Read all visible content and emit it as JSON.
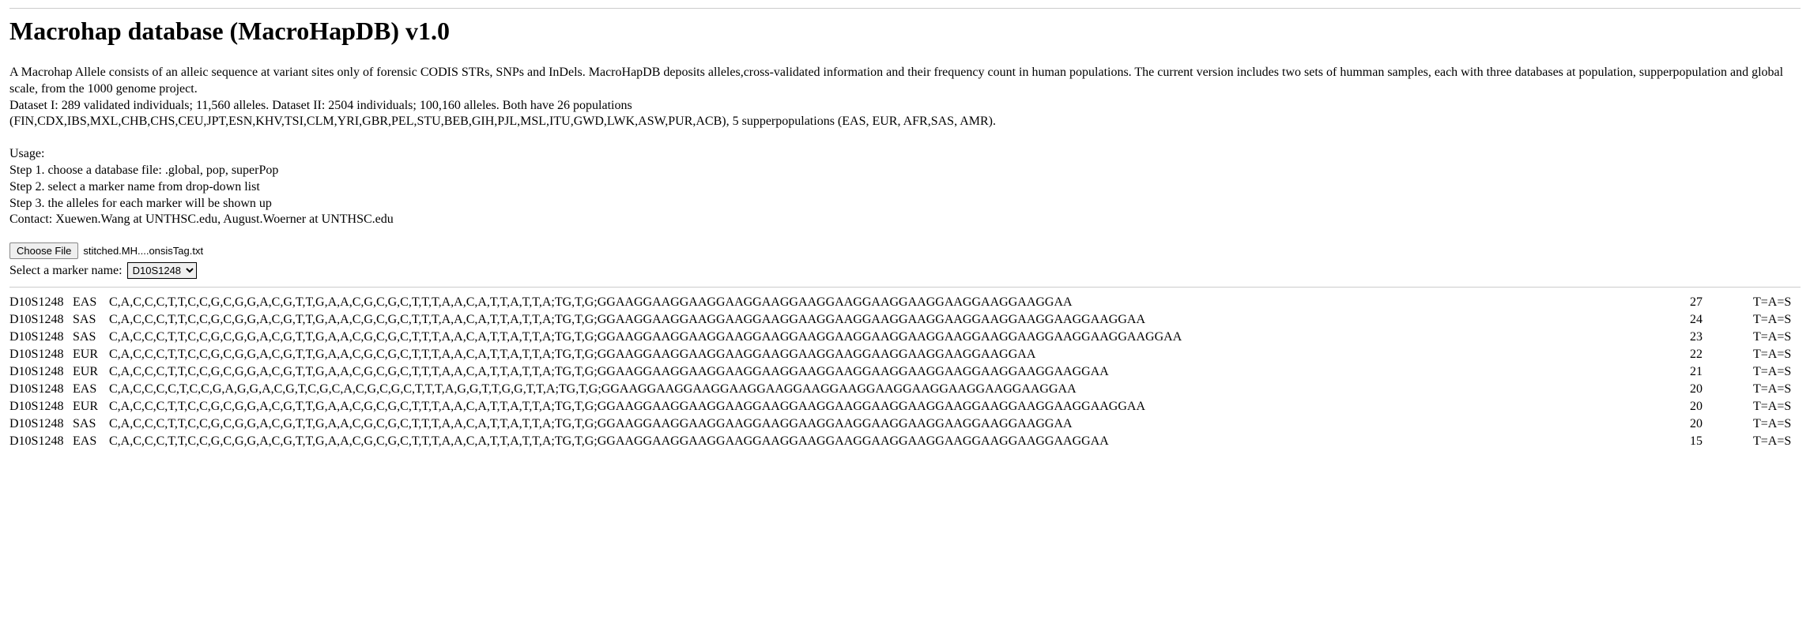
{
  "header": {
    "title": "Macrohap database (MacroHapDB) v1.0"
  },
  "intro": {
    "p1": "A Macrohap Allele consists of an alleic sequence at variant sites only of forensic CODIS STRs, SNPs and InDels. MacroHapDB deposits alleles,cross-validated information and their frequency count in human populations. The current version includes two sets of humman samples, each with three databases at population, supperpopulation and global scale, from the 1000 genome project.",
    "p2": "Dataset I: 289 validated individuals; 11,560 alleles. Dataset II: 2504 individuals; 100,160 alleles. Both have 26 populations",
    "p3": "(FIN,CDX,IBS,MXL,CHB,CHS,CEU,JPT,ESN,KHV,TSI,CLM,YRI,GBR,PEL,STU,BEB,GIH,PJL,MSL,ITU,GWD,LWK,ASW,PUR,ACB), 5 supperpopulations (EAS, EUR, AFR,SAS, AMR)."
  },
  "usage": {
    "label": "Usage:",
    "step1": "Step 1. choose a database file: .global, pop, superPop",
    "step2": "Step 2. select a marker name from drop-down list",
    "step3": "Step 3. the alleles for each marker will be shown up",
    "contact": "Contact: Xuewen.Wang at UNTHSC.edu, August.Woerner at UNTHSC.edu"
  },
  "file": {
    "button": "Choose File",
    "name": "stitched.MH....onsisTag.txt"
  },
  "marker": {
    "label": "Select a marker name:",
    "selected": "D10S1248"
  },
  "rows": [
    {
      "marker": "D10S1248",
      "pop": "EAS",
      "seq": "C,A,C,C,C,T,T,C,C,G,C,G,G,A,C,G,T,T,G,A,A,C,G,C,G,C,T,T,T,A,A,C,A,T,T,A,T,T,A;TG,T,G;GGAAGGAAGGAAGGAAGGAAGGAAGGAAGGAAGGAAGGAAGGAAGGAAGGAA",
      "count": "27",
      "tas": "T=A=S"
    },
    {
      "marker": "D10S1248",
      "pop": "SAS",
      "seq": "C,A,C,C,C,T,T,C,C,G,C,G,G,A,C,G,T,T,G,A,A,C,G,C,G,C,T,T,T,A,A,C,A,T,T,A,T,T,A;TG,T,G;GGAAGGAAGGAAGGAAGGAAGGAAGGAAGGAAGGAAGGAAGGAAGGAAGGAAGGAAGGAA",
      "count": "24",
      "tas": "T=A=S"
    },
    {
      "marker": "D10S1248",
      "pop": "SAS",
      "seq": "C,A,C,C,C,T,T,C,C,G,C,G,G,A,C,G,T,T,G,A,A,C,G,C,G,C,T,T,T,A,A,C,A,T,T,A,T,T,A;TG,T,G;GGAAGGAAGGAAGGAAGGAAGGAAGGAAGGAAGGAAGGAAGGAAGGAAGGAAGGAAGGAAGGAA",
      "count": "23",
      "tas": "T=A=S"
    },
    {
      "marker": "D10S1248",
      "pop": "EUR",
      "seq": "C,A,C,C,C,T,T,C,C,G,C,G,G,A,C,G,T,T,G,A,A,C,G,C,G,C,T,T,T,A,A,C,A,T,T,A,T,T,A;TG,T,G;GGAAGGAAGGAAGGAAGGAAGGAAGGAAGGAAGGAAGGAAGGAAGGAA",
      "count": "22",
      "tas": "T=A=S"
    },
    {
      "marker": "D10S1248",
      "pop": "EUR",
      "seq": "C,A,C,C,C,T,T,C,C,G,C,G,G,A,C,G,T,T,G,A,A,C,G,C,G,C,T,T,T,A,A,C,A,T,T,A,T,T,A;TG,T,G;GGAAGGAAGGAAGGAAGGAAGGAAGGAAGGAAGGAAGGAAGGAAGGAAGGAAGGAA",
      "count": "21",
      "tas": "T=A=S"
    },
    {
      "marker": "D10S1248",
      "pop": "EAS",
      "seq": "C,A,C,C,C,C,T,C,C,G,A,G,G,A,C,G,T,C,G,C,A,C,G,C,G,C,T,T,T,A,G,G,T,T,G,G,T,T,A;TG,T,G;GGAAGGAAGGAAGGAAGGAAGGAAGGAAGGAAGGAAGGAAGGAAGGAAGGAA",
      "count": "20",
      "tas": "T=A=S"
    },
    {
      "marker": "D10S1248",
      "pop": "EUR",
      "seq": "C,A,C,C,C,T,T,C,C,G,C,G,G,A,C,G,T,T,G,A,A,C,G,C,G,C,T,T,T,A,A,C,A,T,T,A,T,T,A;TG,T,G;GGAAGGAAGGAAGGAAGGAAGGAAGGAAGGAAGGAAGGAAGGAAGGAAGGAAGGAAGGAA",
      "count": "20",
      "tas": "T=A=S"
    },
    {
      "marker": "D10S1248",
      "pop": "SAS",
      "seq": "C,A,C,C,C,T,T,C,C,G,C,G,G,A,C,G,T,T,G,A,A,C,G,C,G,C,T,T,T,A,A,C,A,T,T,A,T,T,A;TG,T,G;GGAAGGAAGGAAGGAAGGAAGGAAGGAAGGAAGGAAGGAAGGAAGGAAGGAA",
      "count": "20",
      "tas": "T=A=S"
    },
    {
      "marker": "D10S1248",
      "pop": "EAS",
      "seq": "C,A,C,C,C,T,T,C,C,G,C,G,G,A,C,G,T,T,G,A,A,C,G,C,G,C,T,T,T,A,A,C,A,T,T,A,T,T,A;TG,T,G;GGAAGGAAGGAAGGAAGGAAGGAAGGAAGGAAGGAAGGAAGGAAGGAAGGAAGGAA",
      "count": "15",
      "tas": "T=A=S"
    }
  ]
}
